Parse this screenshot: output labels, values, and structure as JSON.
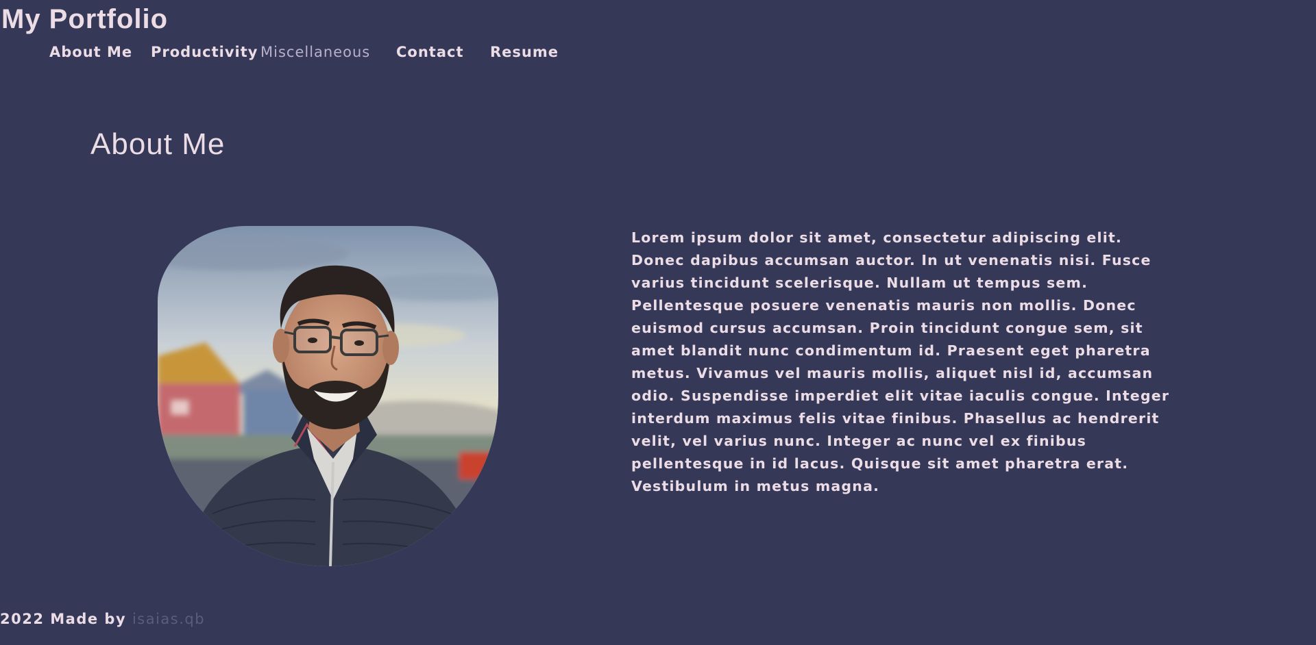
{
  "site": {
    "title": "My Portfolio"
  },
  "nav": {
    "items": [
      {
        "label": "About Me"
      },
      {
        "label": "Productivity"
      },
      {
        "label": "Miscellaneous"
      },
      {
        "label": "Contact"
      },
      {
        "label": "Resume"
      }
    ],
    "active_index": 2
  },
  "main": {
    "heading": "About Me",
    "photo_alt": "Portrait photo",
    "bio": "Lorem ipsum dolor sit amet, consectetur adipiscing elit. Donec dapibus accumsan auctor. In ut venenatis nisi. Fusce varius tincidunt scelerisque. Nullam ut tempus sem. Pellentesque posuere venenatis mauris non mollis. Donec euismod cursus accumsan. Proin tincidunt congue sem, sit amet blandit nunc condimentum id. Praesent eget pharetra metus. Vivamus vel mauris mollis, aliquet nisl id, accumsan odio. Suspendisse imperdiet elit vitae iaculis congue. Integer interdum maximus felis vitae finibus. Phasellus ac hendrerit velit, vel varius nunc. Integer ac nunc vel ex finibus pellentesque in id lacus. Quisque sit amet pharetra erat. Vestibulum in metus magna."
  },
  "footer": {
    "prefix": "2022 Made by",
    "author": "isaias.qb"
  },
  "colors": {
    "background": "#353957",
    "text": "#ecdce6",
    "nav_active": "#bab0c9",
    "footer_link": "#5a5e7c"
  }
}
